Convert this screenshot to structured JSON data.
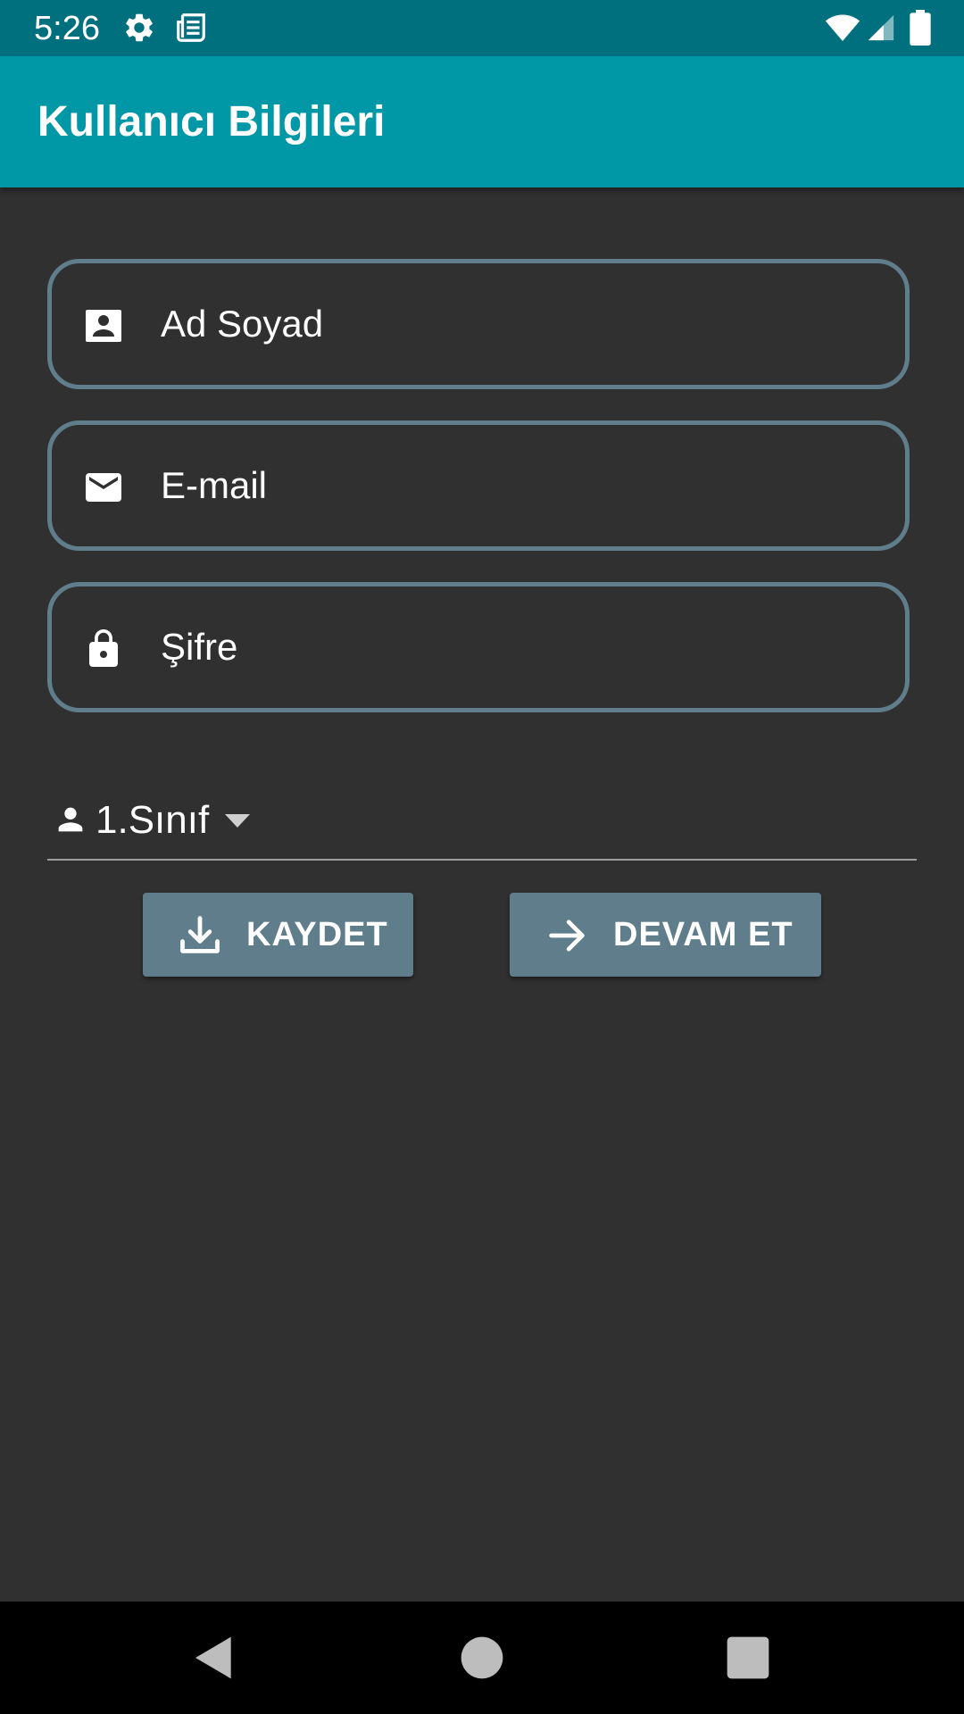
{
  "status_bar": {
    "time": "5:26",
    "icons": [
      "gear-icon",
      "news-icon",
      "wifi-icon",
      "signal-icon",
      "battery-icon"
    ]
  },
  "app_bar": {
    "title": "Kullanıcı Bilgileri"
  },
  "form": {
    "name_field": {
      "placeholder": "Ad Soyad",
      "icon": "contact-card-icon"
    },
    "email_field": {
      "placeholder": "E-mail",
      "icon": "mail-icon"
    },
    "password_field": {
      "placeholder": "Şifre",
      "icon": "lock-icon"
    },
    "class_dropdown": {
      "selected": "1.Sınıf",
      "icon": "person-icon"
    }
  },
  "buttons": {
    "save_label": "KAYDET",
    "continue_label": "DEVAM ET"
  },
  "nav_bar": {
    "items": [
      "back-icon",
      "home-icon",
      "recents-icon"
    ]
  },
  "colors": {
    "status_bar": "#00707f",
    "app_bar": "#0097a7",
    "background": "#303030",
    "accent": "#607d8b",
    "text": "#ffffff"
  }
}
